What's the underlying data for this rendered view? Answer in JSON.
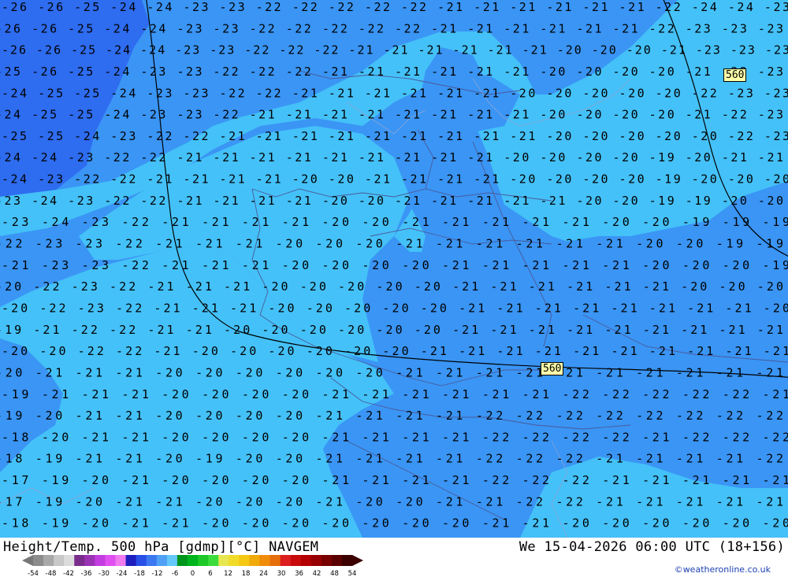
{
  "map": {
    "parameter_title": "Height/Temp. 500 hPa [gdmp][°C] NAVGEM",
    "valid_time": "We 15-04-2026 06:00 UTC (18+156)",
    "credit": "©weatheronline.co.uk",
    "contour_labels": [
      "560",
      "560"
    ],
    "temperature_rows": [
      "-26 -26 -25 -24 -24 -23 -23 -22 -22 -22 -22 -22 -21 -21 -21 -21 -21 -21 -22 -24 -24 -23",
      "-26 -26 -25 -24 -24 -23 -23 -22 -22 -22 -22 -22 -21 -21 -21 -21 -21 -21 -22 -23 -23 -23",
      "-26 -26 -25 -24 -24 -23 -23 -22 -22 -22 -21 -21 -21 -21 -21 -21 -20 -20 -20 -21 -23 -23 -23",
      "-25 -26 -25 -24 -23 -23 -22 -22 -22 -21 -21 -21 -21 -21 -21 -20 -20 -20 -20 -21 -22 -23",
      "-24 -25 -25 -24 -23 -23 -22 -22 -21 -21 -21 -21 -21 -21 -20 -20 -20 -20 -20 -22 -23 -23",
      "-24 -25 -25 -24 -23 -23 -22 -21 -21 -21 -21 -21 -21 -21 -21 -20 -20 -20 -20 -21 -22 -23",
      "-25 -25 -24 -23 -22 -22 -21 -21 -21 -21 -21 -21 -21 -21 -21 -20 -20 -20 -20 -20 -22 -23",
      "-24 -24 -23 -22 -22 -21 -21 -21 -21 -21 -21 -21 -21 -21 -20 -20 -20 -20 -19 -20 -21 -21",
      "-24 -23 -22 -22 -21 -21 -21 -21 -20 -20 -21 -21 -21 -21 -20 -20 -20 -20 -19 -20 -20 -20",
      "-23 -24 -23 -22 -22 -21 -21 -21 -21 -20 -20 -21 -21 -21 -21 -21 -20 -20 -19 -19 -20 -20",
      "-23 -24 -23 -22 -21 -21 -21 -21 -20 -20 -21 -21 -21 -21 -21 -20 -20 -19 -19 -19",
      "-22 -23 -23 -22 -21 -21 -21 -20 -20 -20 -21 -21 -21 -21 -21 -21 -20 -20 -19 -19",
      "-21 -23 -23 -22 -21 -21 -21 -20 -20 -20 -20 -21 -21 -21 -21 -21 -20 -20 -20 -19",
      "-20 -22 -23 -22 -21 -21 -21 -20 -20 -20 -20 -20 -21 -21 -21 -21 -21 -21 -20 -20 -20",
      "-20 -22 -23 -22 -21 -21 -21 -20 -20 -20 -20 -20 -21 -21 -21 -21 -21 -21 -21 -21 -20",
      "-19 -21 -22 -22 -21 -21 -20 -20 -20 -20 -20 -20 -21 -21 -21 -21 -21 -21 -21 -21 -21",
      "-20 -20 -22 -22 -21 -20 -20 -20 -20 -20 -20 -21 -21 -21 -21 -21 -21 -21 -21 -21 -21",
      "-20 -21 -21 -21 -20 -20 -20 -20 -20 -20 -21 -21 -21 -21 -21 -21 -21 -21 -21 -21",
      "-19 -21 -21 -21 -20 -20 -20 -20 -21 -21 -21 -21 -21 -21 -22 -22 -22 -22 -22 -21",
      "-19 -20 -21 -21 -20 -20 -20 -20 -21 -21 -21 -21 -22 -22 -22 -22 -22 -22 -22 -22",
      "-18 -20 -21 -21 -20 -20 -20 -20 -21 -21 -21 -21 -22 -22 -22 -22 -21 -22 -22 -22",
      "-18 -19 -21 -21 -20 -19 -20 -20 -21 -21 -21 -21 -22 -22 -22 -21 -21 -21 -21 -22",
      "-17 -19 -20 -21 -20 -20 -20 -20 -21 -21 -21 -21 -22 -22 -22 -21 -21 -21 -21 -21",
      "-17 -19 -20 -21 -21 -20 -20 -20 -21 -20 -20 -21 -21 -22 -22 -21 -21 -21 -21 -21",
      "-18 -19 -20 -21 -21 -20 -20 -20 -20 -20 -20 -20 -21 -21 -20 -20 -20 -20 -20 -20"
    ]
  },
  "legend": {
    "ticks": [
      "-54",
      "-48",
      "-42",
      "-36",
      "-30",
      "-24",
      "-18",
      "-12",
      "-6",
      "0",
      "6",
      "12",
      "18",
      "24",
      "30",
      "36",
      "42",
      "48",
      "54"
    ],
    "colors": [
      "#8c8c8c",
      "#a8a8a8",
      "#c8c8c8",
      "#dcdcdc",
      "#7a2c8c",
      "#9a32b4",
      "#c23ce0",
      "#e050f0",
      "#f07cf0",
      "#1e1ebe",
      "#2850e6",
      "#3c78f0",
      "#50a0f5",
      "#64c8fa",
      "#00961e",
      "#00b41e",
      "#1ec828",
      "#3cdc3c",
      "#e6e650",
      "#f0dc28",
      "#f5c814",
      "#f0aa0a",
      "#f08c0a",
      "#e66e0a",
      "#dc1e1e",
      "#c80a0a",
      "#b40000",
      "#960000",
      "#780000",
      "#5a0000",
      "#3c0000"
    ]
  }
}
